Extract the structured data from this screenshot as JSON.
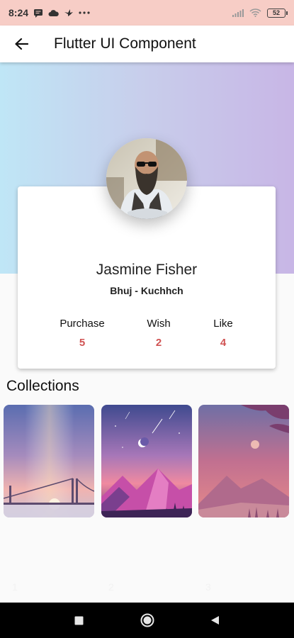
{
  "status_bar": {
    "time": "8:24",
    "left_icons": [
      "message-icon",
      "cloud-icon",
      "bird-icon",
      "more-dots-icon"
    ],
    "right_icons": [
      "signal-icon",
      "wifi-icon"
    ],
    "battery": "52"
  },
  "app_bar": {
    "back_icon": "arrow-back-icon",
    "title": "Flutter UI Component"
  },
  "profile": {
    "name": "Jasmine Fisher",
    "location": "Bhuj - Kuchhch",
    "stats": [
      {
        "label": "Purchase",
        "value": "5"
      },
      {
        "label": "Wish",
        "value": "2"
      },
      {
        "label": "Like",
        "value": "4"
      }
    ]
  },
  "collections": {
    "title": "Collections",
    "items": [
      {
        "index": "1",
        "scene": "bridge-sunset"
      },
      {
        "index": "2",
        "scene": "mountain-night"
      },
      {
        "index": "3",
        "scene": "misty-hills"
      }
    ]
  },
  "nav_bar": {
    "buttons": [
      "recents-square-icon",
      "home-circle-icon",
      "back-triangle-icon"
    ]
  },
  "colors": {
    "status_bar": "#f7cdc6",
    "gradient_start": "#bfe6f6",
    "gradient_end": "#c8b6e6",
    "stat_value": "#d05353"
  }
}
